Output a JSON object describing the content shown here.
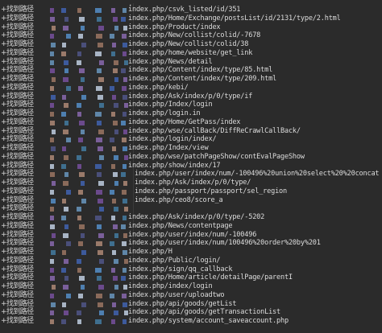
{
  "terminal": {
    "top_marker": ".",
    "prefix": "+找到路径",
    "lines": [
      {
        "path": "index.php/csvk_listed/id/351",
        "mask": 0
      },
      {
        "path": "index.php/Home/Exchange/postsList/id/2131/type/2.html",
        "mask": 1
      },
      {
        "path": "index.php/Product/index",
        "mask": 2
      },
      {
        "path": "index.php/New/collist/colid/-7678",
        "mask": 3
      },
      {
        "path": "index.php/New/collist/colid/38",
        "mask": 4
      },
      {
        "path": "index.php/home/website/get_link",
        "mask": 0
      },
      {
        "path": "index.php/News/detail",
        "mask": 5
      },
      {
        "path": "index.php/Content/index/type/85.html",
        "mask": 1
      },
      {
        "path": "index.php/Content/index/type/209.html",
        "mask": 2
      },
      {
        "path": "index.php/kebi/",
        "mask": 3
      },
      {
        "path": "index.php/Ask/index/p/0/type/if",
        "mask": 4
      },
      {
        "path": "index.php/Index/login",
        "mask": 5
      },
      {
        "path": "index.php/login.in",
        "mask": 0
      },
      {
        "path": "index.php/Home/GetPass/index",
        "mask": 1
      },
      {
        "path": "index.php/wse/callBack/DiffReCrawlCallBack/",
        "mask": 2
      },
      {
        "path": "index.php/login/index/",
        "mask": 3
      },
      {
        "path": "index.php/Index/view",
        "mask": 4
      },
      {
        "path": "index.php/wse/patchPageShow/contEvalPageShow",
        "mask": 5
      },
      {
        "path": "index.php/show/index/17",
        "mask": 0
      },
      {
        "path": "index.php/user/index/num/-100496%20union%20select%20%20concat",
        "mask": 1
      },
      {
        "path": "index.php/Ask/index/p/0/type/",
        "mask": 2
      },
      {
        "path": "index.php/passport/passport/sel_region",
        "mask": 3
      },
      {
        "path": "index.php/ceo8/score_a",
        "mask": 4
      },
      {
        "path": "",
        "mask": 5
      },
      {
        "path": "index.php/Ask/index/p/0/type/-5202",
        "mask": 0
      },
      {
        "path": "index.php/News/contentpage",
        "mask": 1
      },
      {
        "path": "index.php/user/index/num/-100496",
        "mask": 2
      },
      {
        "path": "index.php/user/index/num/100496%20order%20by%201",
        "mask": 3
      },
      {
        "path": "index.php/H",
        "mask": 4
      },
      {
        "path": "index.php/Public/login/",
        "mask": 5
      },
      {
        "path": "index.php/sign/qq_callback",
        "mask": 0
      },
      {
        "path": "index.php/Home/article/detailPage/parentI",
        "mask": 1
      },
      {
        "path": "index.php/index/login",
        "mask": 2
      },
      {
        "path": "index.php/user/uploadtwo",
        "mask": 3
      },
      {
        "path": "index.php/api/goods/getList",
        "mask": 4
      },
      {
        "path": "index.php/api/goods/getTransactionList",
        "mask": 5
      },
      {
        "path": "index.php/system/account_saveaccount.php",
        "mask": 0
      }
    ]
  },
  "colors": {
    "background": "#2b2b2b",
    "text": "#dcdcdc",
    "redaction_palette": [
      "#6b4a8c",
      "#3d5a9c",
      "#8a6a5a",
      "#4e7fb0",
      "#7a5f9a",
      "#5f86a8",
      "#9a7a6a",
      "#4a4f7a",
      "#a8b4c4",
      "#3f6f8f"
    ]
  }
}
